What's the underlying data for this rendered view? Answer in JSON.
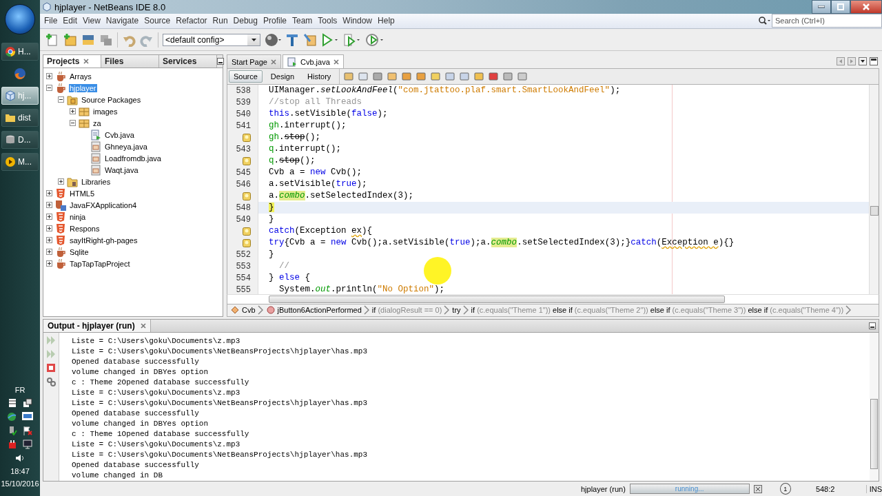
{
  "taskbar": {
    "buttons": [
      {
        "kind": "chrome",
        "label": "H...",
        "selected": false
      },
      {
        "kind": "firefox",
        "selected": false
      },
      {
        "kind": "netbeans",
        "label": "hj...",
        "selected": true
      },
      {
        "kind": "folder",
        "label": "dist",
        "selected": false
      },
      {
        "kind": "database",
        "label": "D...",
        "selected": false
      },
      {
        "kind": "media",
        "label": "M...",
        "selected": false
      }
    ],
    "tray": {
      "language": "FR",
      "time": "18:47",
      "date": "15/10/2016"
    }
  },
  "window": {
    "title": "hjplayer - NetBeans IDE 8.0"
  },
  "menu": [
    "File",
    "Edit",
    "View",
    "Navigate",
    "Source",
    "Refactor",
    "Run",
    "Debug",
    "Profile",
    "Team",
    "Tools",
    "Window",
    "Help"
  ],
  "search": {
    "placeholder": "Search (Ctrl+I)"
  },
  "toolbar": {
    "config": "<default config>"
  },
  "projects_panel": {
    "tabs": [
      {
        "label": "Projects",
        "selected": true
      },
      {
        "label": "Files",
        "selected": false
      },
      {
        "label": "Services",
        "selected": false
      }
    ],
    "tree": [
      {
        "label": "Arrays",
        "kind": "project",
        "expanded": false,
        "selected": false
      },
      {
        "label": "hjplayer",
        "kind": "project",
        "expanded": true,
        "selected": true,
        "children": [
          {
            "label": "Source Packages",
            "kind": "sources",
            "expanded": true,
            "selected": false,
            "children": [
              {
                "label": "images",
                "kind": "package",
                "expanded": false,
                "selected": false
              },
              {
                "label": "za",
                "kind": "package",
                "expanded": true,
                "selected": false,
                "children": [
                  {
                    "label": "Cvb.java",
                    "kind": "main-class",
                    "selected": false
                  },
                  {
                    "label": "Ghneya.java",
                    "kind": "form",
                    "selected": false
                  },
                  {
                    "label": "Loadfromdb.java",
                    "kind": "form",
                    "selected": false
                  },
                  {
                    "label": "Waqt.java",
                    "kind": "form",
                    "selected": false
                  }
                ]
              }
            ]
          },
          {
            "label": "Libraries",
            "kind": "libraries",
            "expanded": false,
            "selected": false
          }
        ]
      },
      {
        "label": "HTML5",
        "kind": "html5",
        "expanded": false,
        "selected": false
      },
      {
        "label": "JavaFXApplication4",
        "kind": "javafx",
        "expanded": false,
        "selected": false
      },
      {
        "label": "ninja",
        "kind": "html5",
        "expanded": false,
        "selected": false
      },
      {
        "label": "Respons",
        "kind": "html5",
        "expanded": false,
        "selected": false
      },
      {
        "label": "sayItRight-gh-pages",
        "kind": "html5",
        "expanded": false,
        "selected": false
      },
      {
        "label": "Sqlite",
        "kind": "project",
        "expanded": false,
        "selected": false
      },
      {
        "label": "TapTapTapProject",
        "kind": "project",
        "expanded": false,
        "selected": false
      }
    ]
  },
  "editor": {
    "tabs": [
      {
        "label": "Start Page",
        "selected": false
      },
      {
        "label": "Cvb.java",
        "selected": true
      }
    ],
    "views": [
      {
        "label": "Source",
        "selected": true
      },
      {
        "label": "Design",
        "selected": false
      },
      {
        "label": "History",
        "selected": false
      }
    ],
    "lines": [
      {
        "number": "538",
        "hint": false,
        "current": false,
        "segs": [
          {
            "text": "UIManager.",
            "kind": "plain"
          },
          {
            "text": "setLookAndFeel",
            "kind": "static"
          },
          {
            "text": "(",
            "kind": "plain"
          },
          {
            "text": "\"com.jtattoo.plaf.smart.SmartLookAndFeel\"",
            "kind": "string"
          },
          {
            "text": ");",
            "kind": "plain"
          }
        ]
      },
      {
        "number": "539",
        "hint": false,
        "current": false,
        "segs": [
          {
            "text": "//stop all Threads",
            "kind": "comment"
          }
        ]
      },
      {
        "number": "540",
        "hint": false,
        "current": false,
        "segs": [
          {
            "text": "this",
            "kind": "keyword"
          },
          {
            "text": ".setVisible(",
            "kind": "plain"
          },
          {
            "text": "false",
            "kind": "keyword"
          },
          {
            "text": ");",
            "kind": "plain"
          }
        ]
      },
      {
        "number": "541",
        "hint": false,
        "current": false,
        "segs": [
          {
            "text": "gh",
            "kind": "field"
          },
          {
            "text": ".interrupt();",
            "kind": "plain"
          }
        ]
      },
      {
        "hint": true,
        "current": false,
        "segs": [
          {
            "text": "gh",
            "kind": "field"
          },
          {
            "text": ".",
            "kind": "plain"
          },
          {
            "text": "stop",
            "kind": "deprecated"
          },
          {
            "text": "();",
            "kind": "plain"
          }
        ]
      },
      {
        "number": "543",
        "hint": false,
        "current": false,
        "segs": [
          {
            "text": "q",
            "kind": "field"
          },
          {
            "text": ".interrupt();",
            "kind": "plain"
          }
        ]
      },
      {
        "hint": true,
        "current": false,
        "segs": [
          {
            "text": "q",
            "kind": "field"
          },
          {
            "text": ".",
            "kind": "plain"
          },
          {
            "text": "stop",
            "kind": "deprecated"
          },
          {
            "text": "();",
            "kind": "plain"
          }
        ]
      },
      {
        "number": "545",
        "hint": false,
        "current": false,
        "segs": [
          {
            "text": "Cvb a = ",
            "kind": "plain"
          },
          {
            "text": "new",
            "kind": "keyword"
          },
          {
            "text": " Cvb();",
            "kind": "plain"
          }
        ]
      },
      {
        "number": "546",
        "hint": false,
        "current": false,
        "segs": [
          {
            "text": "a.setVisible(",
            "kind": "plain"
          },
          {
            "text": "true",
            "kind": "keyword"
          },
          {
            "text": ");",
            "kind": "plain"
          }
        ]
      },
      {
        "hint": true,
        "current": false,
        "segs": [
          {
            "text": "a.",
            "kind": "plain"
          },
          {
            "text": "combo",
            "kind": "mark"
          },
          {
            "text": ".setSelectedIndex(3);",
            "kind": "plain"
          }
        ]
      },
      {
        "number": "548",
        "hint": false,
        "current": true,
        "segs": [
          {
            "text": "}",
            "kind": "bracket"
          }
        ]
      },
      {
        "number": "549",
        "hint": false,
        "current": false,
        "segs": [
          {
            "text": "}",
            "kind": "plain"
          }
        ]
      },
      {
        "hint": true,
        "current": false,
        "segs": [
          {
            "text": "catch",
            "kind": "keyword"
          },
          {
            "text": "(Exception ",
            "kind": "plain"
          },
          {
            "text": "ex",
            "kind": "warning"
          },
          {
            "text": "){",
            "kind": "plain"
          }
        ]
      },
      {
        "hint": true,
        "current": false,
        "segs": [
          {
            "text": "try",
            "kind": "keyword"
          },
          {
            "text": "{Cvb a = ",
            "kind": "plain"
          },
          {
            "text": "new",
            "kind": "keyword"
          },
          {
            "text": " Cvb();a.setVisible(",
            "kind": "plain"
          },
          {
            "text": "true",
            "kind": "keyword"
          },
          {
            "text": ");a.",
            "kind": "plain"
          },
          {
            "text": "combo",
            "kind": "mark"
          },
          {
            "text": ".setSelectedIndex(3);}",
            "kind": "plain"
          },
          {
            "text": "catch",
            "kind": "keyword"
          },
          {
            "text": "(",
            "kind": "plain"
          },
          {
            "text": "Exception e",
            "kind": "warning"
          },
          {
            "text": "){}",
            "kind": "plain"
          }
        ]
      },
      {
        "number": "552",
        "hint": false,
        "current": false,
        "segs": [
          {
            "text": "}",
            "kind": "plain"
          }
        ]
      },
      {
        "number": "553",
        "hint": false,
        "current": false,
        "segs": [
          {
            "text": "  //",
            "kind": "comment"
          }
        ]
      },
      {
        "number": "554",
        "hint": false,
        "current": false,
        "segs": [
          {
            "text": "} ",
            "kind": "plain"
          },
          {
            "text": "else",
            "kind": "keyword"
          },
          {
            "text": " {",
            "kind": "plain"
          }
        ]
      },
      {
        "number": "555",
        "hint": false,
        "current": false,
        "segs": [
          {
            "text": "  System.",
            "kind": "plain"
          },
          {
            "text": "out",
            "kind": "static-field"
          },
          {
            "text": ".println(",
            "kind": "plain"
          },
          {
            "text": "\"No Option\"",
            "kind": "string"
          },
          {
            "text": ");",
            "kind": "plain"
          }
        ]
      }
    ],
    "breadcrumbs": [
      {
        "kind": "class",
        "parts": [
          {
            "text": "Cvb",
            "kind": "code"
          }
        ]
      },
      {
        "kind": "method",
        "parts": [
          {
            "text": "jButton6ActionPerformed",
            "kind": "code"
          }
        ]
      },
      {
        "kind": "statement",
        "parts": [
          {
            "text": "if",
            "kind": "code"
          },
          {
            "text": " (dialogResult == 0)",
            "kind": "cond"
          }
        ]
      },
      {
        "kind": "statement",
        "parts": [
          {
            "text": "try",
            "kind": "code"
          }
        ]
      },
      {
        "kind": "statement",
        "parts": [
          {
            "text": "if",
            "kind": "code"
          },
          {
            "text": " (c.equals(\"Theme 1\")) ",
            "kind": "cond"
          },
          {
            "text": "else if",
            "kind": "code"
          },
          {
            "text": " (c.equals(\"Theme 2\")) ",
            "kind": "cond"
          },
          {
            "text": "else if",
            "kind": "code"
          },
          {
            "text": " (c.equals(\"Theme 3\")) ",
            "kind": "cond"
          },
          {
            "text": "else if",
            "kind": "code"
          },
          {
            "text": " (c.equals(\"Theme 4\"))",
            "kind": "cond"
          }
        ]
      }
    ]
  },
  "output": {
    "title": "Output - hjplayer (run)",
    "lines": [
      "Liste = C:\\Users\\goku\\Documents\\z.mp3",
      "Liste = C:\\Users\\goku\\Documents\\NetBeansProjects\\hjplayer\\has.mp3",
      "Opened database successfully",
      "volume changed in DBYes option",
      "c : Theme 2Opened database successfully",
      "Liste = C:\\Users\\goku\\Documents\\z.mp3",
      "Liste = C:\\Users\\goku\\Documents\\NetBeansProjects\\hjplayer\\has.mp3",
      "Opened database successfully",
      "volume changed in DBYes option",
      "c : Theme 1Opened database successfully",
      "Liste = C:\\Users\\goku\\Documents\\z.mp3",
      "Liste = C:\\Users\\goku\\Documents\\NetBeansProjects\\hjplayer\\has.mp3",
      "Opened database successfully",
      "volume changed in DB"
    ]
  },
  "status_bar": {
    "task": "hjplayer (run)",
    "progress": {
      "label": "running...",
      "level": 1
    },
    "notifications": "1",
    "position": "548:2",
    "mode": "INS"
  }
}
